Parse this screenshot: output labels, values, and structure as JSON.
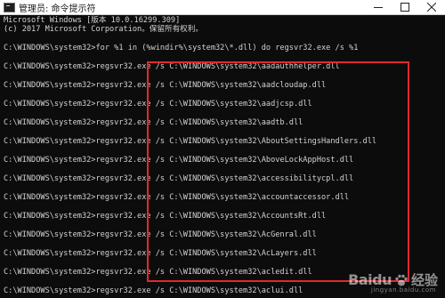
{
  "window": {
    "title": "管理员: 命令提示符",
    "controls": {
      "minimize": "—",
      "maximize": "☐",
      "close": "✕"
    }
  },
  "console": {
    "header_lines": [
      "Microsoft Windows [版本 10.0.16299.309]",
      "(c) 2017 Microsoft Corporation。保留所有权利。"
    ],
    "command": "C:\\WINDOWS\\system32>for %1 in (%windir%\\system32\\*.dll) do regsvr32.exe /s %1",
    "output_lines": [
      "C:\\WINDOWS\\system32>regsvr32.exe /s C:\\WINDOWS\\system32\\aadauthhelper.dll",
      "C:\\WINDOWS\\system32>regsvr32.exe /s C:\\WINDOWS\\system32\\aadcloudap.dll",
      "C:\\WINDOWS\\system32>regsvr32.exe /s C:\\WINDOWS\\system32\\aadjcsp.dll",
      "C:\\WINDOWS\\system32>regsvr32.exe /s C:\\WINDOWS\\system32\\aadtb.dll",
      "C:\\WINDOWS\\system32>regsvr32.exe /s C:\\WINDOWS\\system32\\AboutSettingsHandlers.dll",
      "C:\\WINDOWS\\system32>regsvr32.exe /s C:\\WINDOWS\\system32\\AboveLockAppHost.dll",
      "C:\\WINDOWS\\system32>regsvr32.exe /s C:\\WINDOWS\\system32\\accessibilitycpl.dll",
      "C:\\WINDOWS\\system32>regsvr32.exe /s C:\\WINDOWS\\system32\\accountaccessor.dll",
      "C:\\WINDOWS\\system32>regsvr32.exe /s C:\\WINDOWS\\system32\\AccountsRt.dll",
      "C:\\WINDOWS\\system32>regsvr32.exe /s C:\\WINDOWS\\system32\\AcGenral.dll",
      "C:\\WINDOWS\\system32>regsvr32.exe /s C:\\WINDOWS\\system32\\AcLayers.dll",
      "C:\\WINDOWS\\system32>regsvr32.exe /s C:\\WINDOWS\\system32\\acledit.dll",
      "C:\\WINDOWS\\system32>regsvr32.exe /s C:\\WINDOWS\\system32\\aclui.dll"
    ]
  },
  "watermark": {
    "brand": "Baidu",
    "suffix": "经验",
    "sub": "jingyan.baidu.com"
  },
  "colors": {
    "console_bg": "#0c0c0c",
    "console_text": "#d3d3d3",
    "highlight_box": "#e0292e"
  }
}
